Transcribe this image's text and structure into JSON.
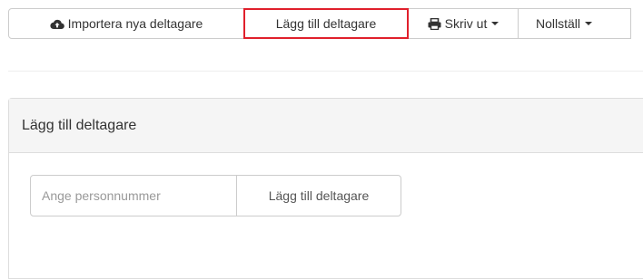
{
  "toolbar": {
    "import_label": "Importera nya deltagare",
    "add_label": "Lägg till deltagare",
    "print_label": "Skriv ut",
    "reset_label": "Nollställ"
  },
  "panel": {
    "title": "Lägg till deltagare",
    "input_placeholder": "Ange personnummer",
    "input_value": "",
    "add_button_label": "Lägg till deltagare"
  },
  "icons": {
    "import": "cloud-upload-icon",
    "print": "print-icon",
    "dropdown": "caret-down-icon"
  },
  "colors": {
    "highlight_border": "#e0202c"
  }
}
